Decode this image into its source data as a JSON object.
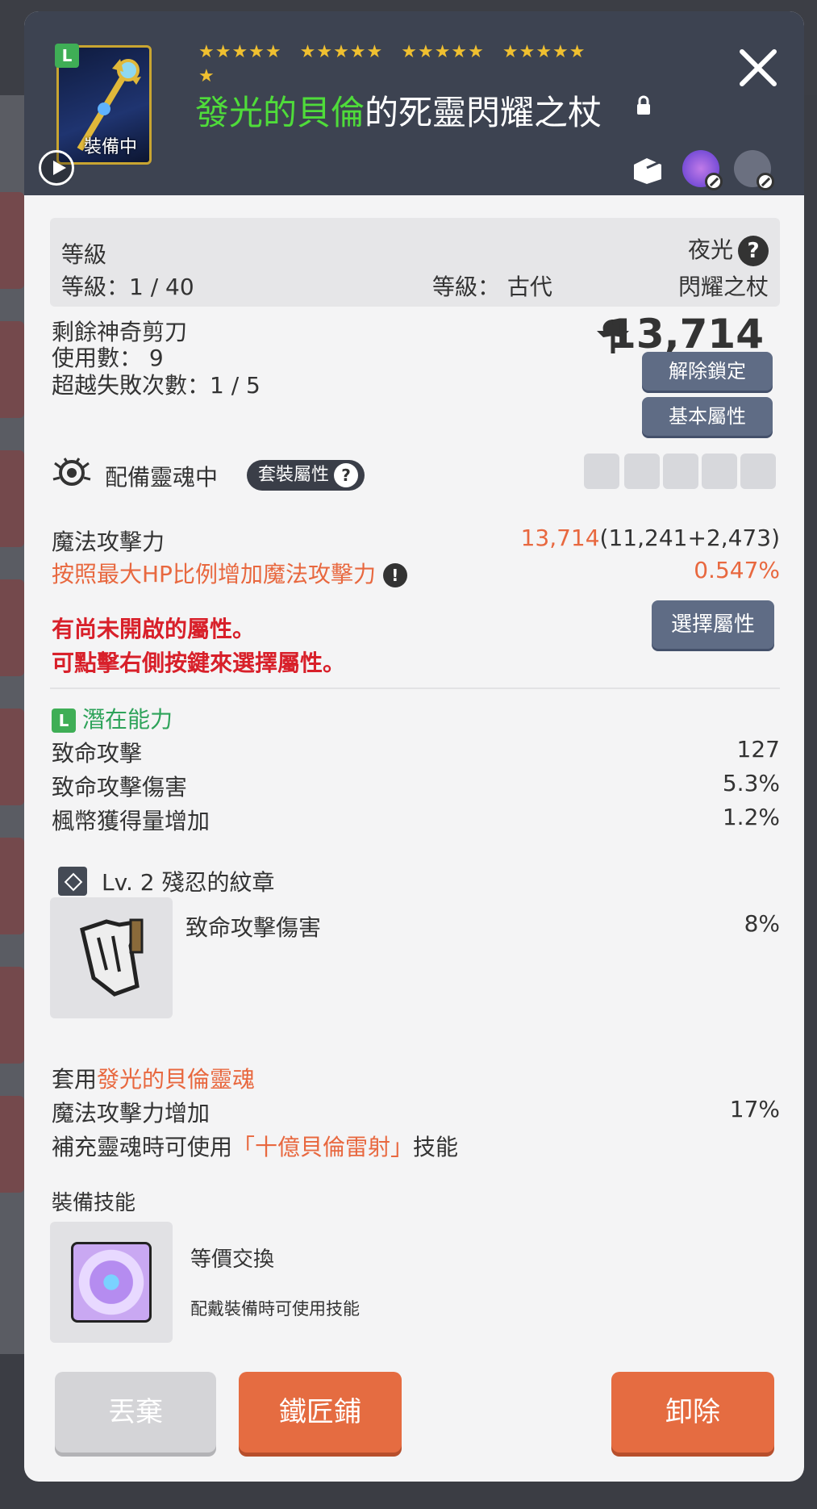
{
  "header": {
    "stars": [
      "★★★★★",
      "★★★★★",
      "★★★★★",
      "★★★★★",
      "★"
    ],
    "equipped_label": "裝備中",
    "item_title_highlight": "發光的貝倫",
    "item_title_rest": "的死靈閃耀之杖",
    "potential_badge": "L"
  },
  "level_box": {
    "label": "等級",
    "level_value": "等級：1 / 40",
    "grade": "等級： 古代",
    "class": "夜光",
    "weapon_type": "閃耀之杖"
  },
  "scissors": {
    "line1": "剩餘神奇剪刀",
    "line2": "使用數： 9",
    "fail_count": "超越失敗次數：1 / 5",
    "combat_power": "13,714",
    "unlock_button": "解除鎖定",
    "base_stats_button": "基本屬性"
  },
  "soul": {
    "label": "配備靈魂中",
    "set_badge": "套裝屬性"
  },
  "stats": {
    "magic_attack_label": "魔法攻擊力",
    "magic_attack_total": "13,714",
    "magic_attack_breakdown": "(11,241+2,473)",
    "hp_ratio_label": "按照最大HP比例增加魔法攻擊力",
    "hp_ratio_value": "0.547%",
    "warning_line1": "有尚未開啟的屬性。",
    "warning_line2": "可點擊右側按鍵來選擇屬性。",
    "select_button": "選擇屬性"
  },
  "potential": {
    "badge": "L",
    "title": "潛在能力",
    "rows": [
      {
        "label": "致命攻擊",
        "value": "127"
      },
      {
        "label": "致命攻擊傷害",
        "value": "5.3%"
      },
      {
        "label": "楓幣獲得量增加",
        "value": "1.2%"
      }
    ]
  },
  "emblem": {
    "title": "Lv. 2 殘忍的紋章",
    "stat_label": "致命攻擊傷害",
    "stat_value": "8%"
  },
  "soul_set": {
    "prefix": "套用",
    "soul_name": "發光的貝倫靈魂",
    "magic_label": "魔法攻擊力增加",
    "magic_value": "17%",
    "skill_prefix": "補充靈魂時可使用",
    "skill_name": "「十億貝倫雷射」",
    "skill_suffix": "技能"
  },
  "equip_skill": {
    "section_title": "裝備技能",
    "name": "等價交換",
    "desc": "配戴裝備時可使用技能"
  },
  "footer": {
    "discard": "丟棄",
    "blacksmith": "鐵匠鋪",
    "unequip": "卸除"
  },
  "colors": {
    "accent_orange": "#e56c41",
    "title_green": "#4fdc3a",
    "warning_red": "#d8202a",
    "header_bg": "#3d4351"
  }
}
